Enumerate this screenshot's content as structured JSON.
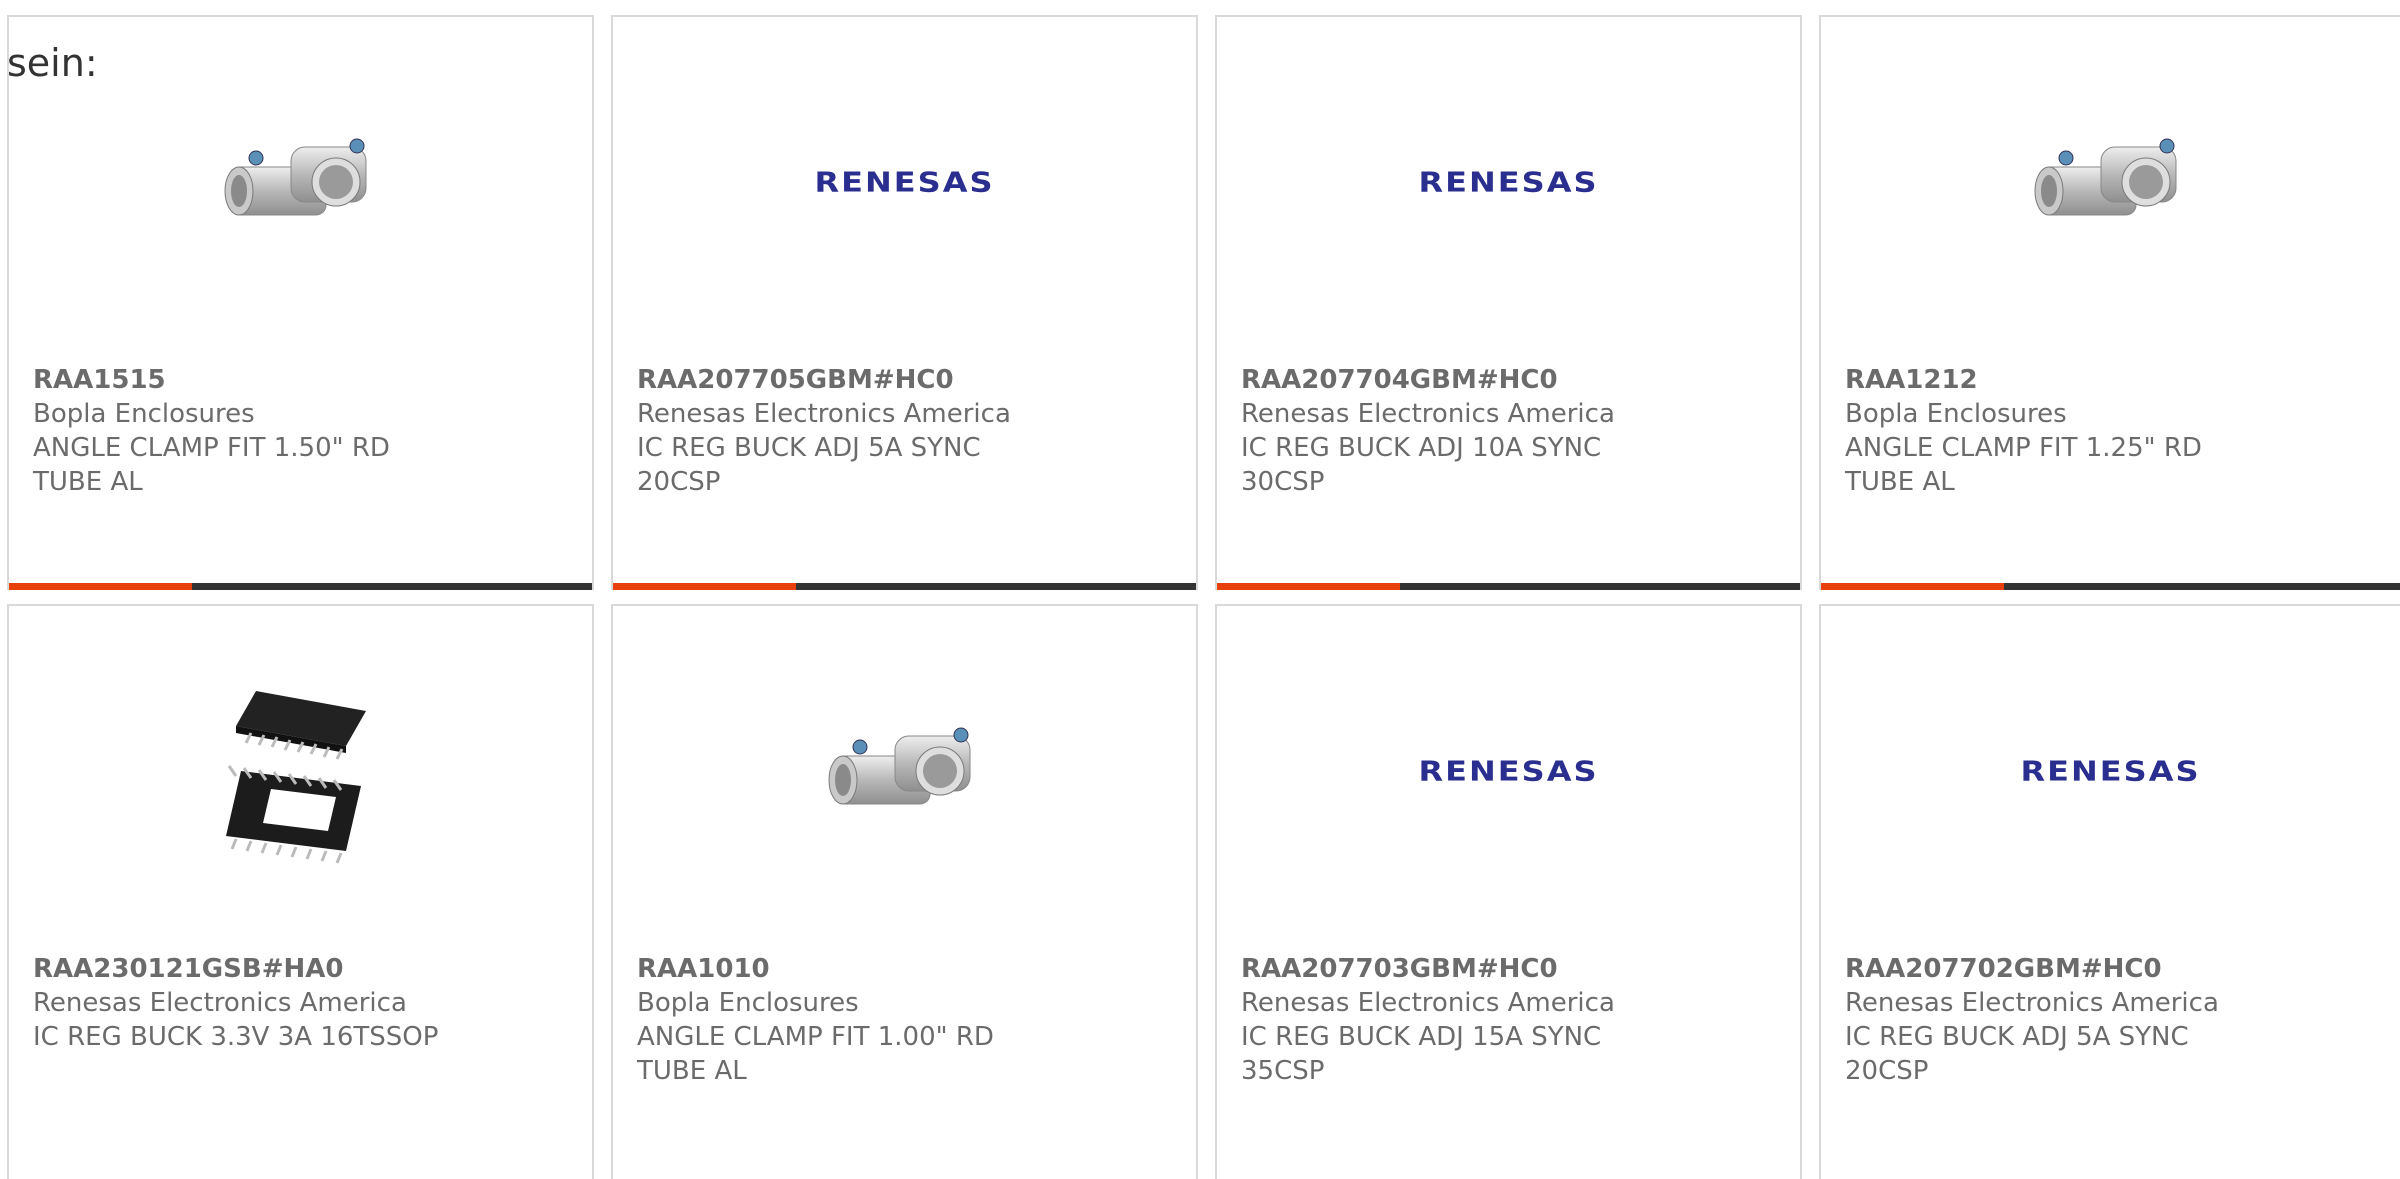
{
  "page": {
    "heading": "sein:"
  },
  "products": [
    {
      "part_number": "RAA1515",
      "manufacturer": "Bopla Enclosures",
      "description": "ANGLE CLAMP FIT 1.50\" RD TUBE AL",
      "image": "angle-clamp-image"
    },
    {
      "part_number": "RAA207705GBM#HC0",
      "manufacturer": "Renesas Electronics America",
      "description": "IC REG BUCK ADJ 5A SYNC 20CSP",
      "image": "renesas-logo"
    },
    {
      "part_number": "RAA207704GBM#HC0",
      "manufacturer": "Renesas Electronics America",
      "description": "IC REG BUCK ADJ 10A SYNC 30CSP",
      "image": "renesas-logo"
    },
    {
      "part_number": "RAA1212",
      "manufacturer": "Bopla Enclosures",
      "description": "ANGLE CLAMP FIT 1.25\" RD TUBE AL",
      "image": "angle-clamp-image"
    },
    {
      "part_number": "RAA230121GSB#HA0",
      "manufacturer": "Renesas Electronics America",
      "description": "IC REG BUCK 3.3V 3A 16TSSOP",
      "image": "tssop-chip-image"
    },
    {
      "part_number": "RAA1010",
      "manufacturer": "Bopla Enclosures",
      "description": "ANGLE CLAMP FIT 1.00\" RD TUBE AL",
      "image": "angle-clamp-image"
    },
    {
      "part_number": "RAA207703GBM#HC0",
      "manufacturer": "Renesas Electronics America",
      "description": "IC REG BUCK ADJ 15A SYNC 35CSP",
      "image": "renesas-logo"
    },
    {
      "part_number": "RAA207702GBM#HC0",
      "manufacturer": "Renesas Electronics America",
      "description": "IC REG BUCK ADJ 5A SYNC 20CSP",
      "image": "renesas-logo"
    }
  ],
  "logo_text": "RENESAS",
  "colors": {
    "accent": "#e8400c",
    "bar_dark": "#333333",
    "logo_blue": "#2a2f8f",
    "text": "#6b6b6b",
    "border": "#d9d9d9"
  }
}
